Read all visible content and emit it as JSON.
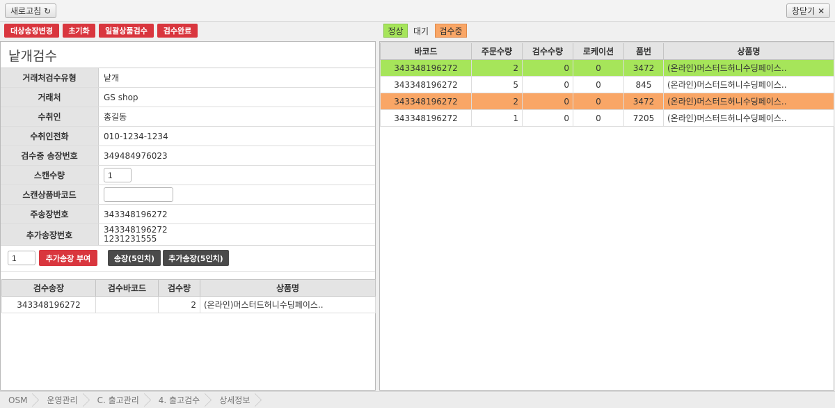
{
  "topbar": {
    "refresh_label": "새로고침",
    "close_label": "창닫기"
  },
  "actions": {
    "change_target_invoice": "대상송장변경",
    "reset": "초기화",
    "bulk_inspect": "일괄상품검수",
    "inspect_complete": "검수완료"
  },
  "legend": {
    "normal": "정상",
    "waiting": "대기",
    "inspecting": "검수중",
    "colors": {
      "normal": "#a6e55a",
      "inspecting": "#f9a666"
    }
  },
  "panel": {
    "title": "낱개검수",
    "fields": {
      "type_label": "거래처검수유형",
      "type_value": "낱개",
      "client_label": "거래처",
      "client_value": "GS shop",
      "recipient_label": "수취인",
      "recipient_value": "홍길동",
      "phone_label": "수취인전화",
      "phone_value": "010-1234-1234",
      "invoice_label": "검수중 송장번호",
      "invoice_value": "349484976023",
      "scan_qty_label": "스캔수량",
      "scan_qty_value": "1",
      "scan_barcode_label": "스캔상품바코드",
      "scan_barcode_value": "",
      "main_invoice_label": "주송장번호",
      "main_invoice_value": "343348196272",
      "extra_invoice_label": "추가송장번호",
      "extra_invoice_values": [
        "343348196272",
        "1231231555"
      ]
    },
    "extra_qty_value": "1",
    "assign_extra_label": "추가송장 부여",
    "invoice5_label": "송장(5인치)",
    "extra_invoice5_label": "추가송장(5인치)"
  },
  "inspect_table": {
    "headers": [
      "검수송장",
      "검수바코드",
      "검수량",
      "상품명"
    ],
    "rows": [
      {
        "invoice": "343348196272",
        "barcode": "",
        "qty": "2",
        "product": "(온라인)머스터드허니수딩페이스.."
      }
    ]
  },
  "order_table": {
    "headers": [
      "바코드",
      "주문수량",
      "검수수량",
      "로케이션",
      "품번",
      "상품명"
    ],
    "rows": [
      {
        "status": "green",
        "barcode": "343348196272",
        "order_qty": "2",
        "inspect_qty": "0",
        "location": "0",
        "item_no": "3472",
        "product": "(온라인)머스터드허니수딩페이스.."
      },
      {
        "status": "none",
        "barcode": "343348196272",
        "order_qty": "5",
        "inspect_qty": "0",
        "location": "0",
        "item_no": "845",
        "product": "(온라인)머스터드허니수딩페이스.."
      },
      {
        "status": "orange",
        "barcode": "343348196272",
        "order_qty": "2",
        "inspect_qty": "0",
        "location": "0",
        "item_no": "3472",
        "product": "(온라인)머스터드허니수딩페이스.."
      },
      {
        "status": "none",
        "barcode": "343348196272",
        "order_qty": "1",
        "inspect_qty": "0",
        "location": "0",
        "item_no": "7205",
        "product": "(온라인)머스터드허니수딩페이스.."
      }
    ]
  },
  "breadcrumb": [
    "OSM",
    "운영관리",
    "C. 출고관리",
    "4. 출고검수",
    "상세정보"
  ]
}
